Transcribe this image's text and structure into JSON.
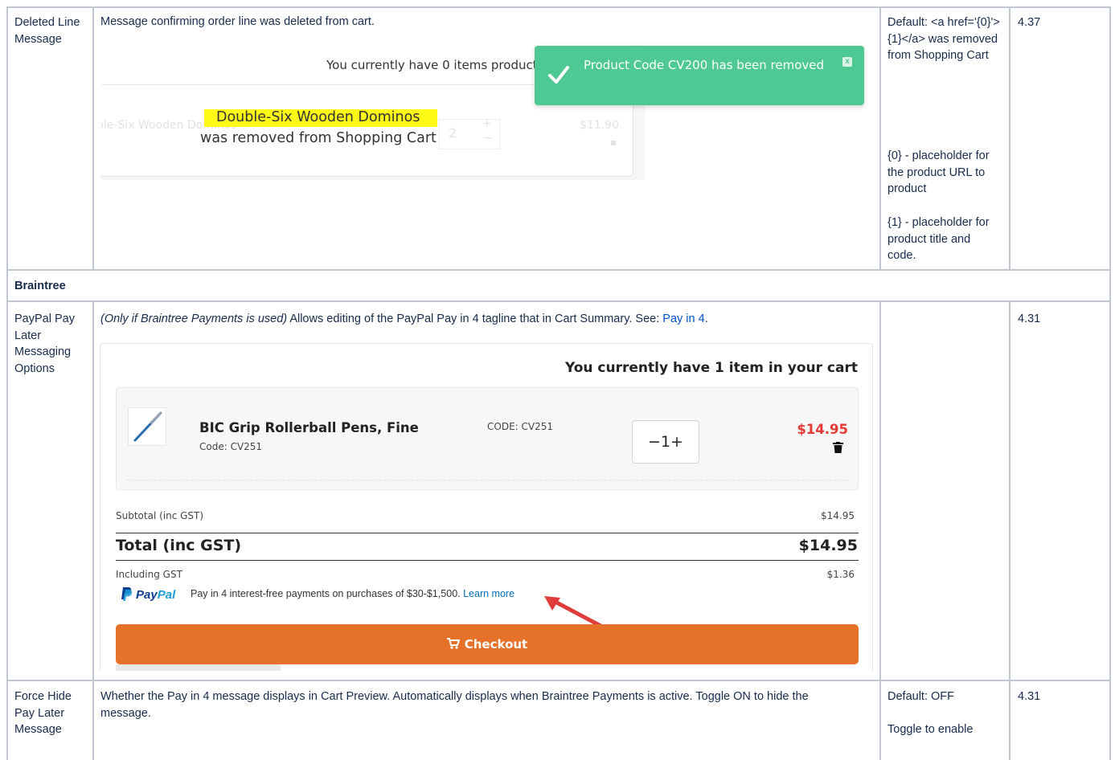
{
  "rows": {
    "deleted": {
      "name": "Deleted Line Message",
      "description": "Message confirming order line was deleted from cart.",
      "default": "Default: <a href='{0}'>{1}</a> was removed from Shopping Cart",
      "placeholder0": "{0} - placeholder for the product URL to product",
      "placeholder1": "{1} - placeholder for product title and code.",
      "version": "4.37"
    },
    "section": {
      "label": "Braintree"
    },
    "paypal": {
      "name": "PayPal Pay Later Messaging Options",
      "desc_italic": "(Only if Braintree Payments is used)",
      "desc_text": " Allows editing of the PayPal Pay in 4 tagline that in Cart Summary. See: ",
      "desc_link": "Pay in 4",
      "desc_end": ".",
      "version": "4.31"
    },
    "force": {
      "name": "Force Hide Pay Later Message",
      "description": "Whether the Pay in 4 message displays in Cart Preview. Automatically displays when Braintree Payments is active. Toggle ON to hide the message.",
      "default": "Default: OFF",
      "toggle": "Toggle to enable",
      "version": "4.31"
    }
  },
  "snapshot1": {
    "cart_title": "You currently have 0 items products in your cart",
    "faded_product": "ble-Six Wooden Dominos",
    "faded_qty": "2",
    "faded_price": "$11.90",
    "highlight_text": "Double-Six Wooden Dominos",
    "removed_text": "was removed from Shopping Cart",
    "toast_text": "Product Code CV200 has been removed",
    "toast_close": "x"
  },
  "snapshot2": {
    "cart_heading": "You currently have 1 item in your cart",
    "item_name": "BIC Grip Rollerball Pens, Fine",
    "item_code": "Code: CV251",
    "item_code_col": "CODE: CV251",
    "qty": "−1+",
    "price": "$14.95",
    "subtotal_label": "Subtotal (inc GST)",
    "subtotal_value": "$14.95",
    "total_label": "Total (inc GST)",
    "total_value": "$14.95",
    "gst_label": "Including GST",
    "gst_value": "$1.36",
    "paypal_brand_a": "Pay",
    "paypal_brand_b": "Pal",
    "paypal_message": "Pay in 4 interest-free payments on purchases of $30-$1,500. ",
    "learn_more": "Learn more",
    "checkout": "Checkout"
  },
  "colors": {
    "toast": "#4fc994",
    "checkout": "#e6722a",
    "price": "#e53935",
    "highlight": "#fffb16",
    "link": "#0052cc",
    "arrow": "#e03c3c"
  }
}
